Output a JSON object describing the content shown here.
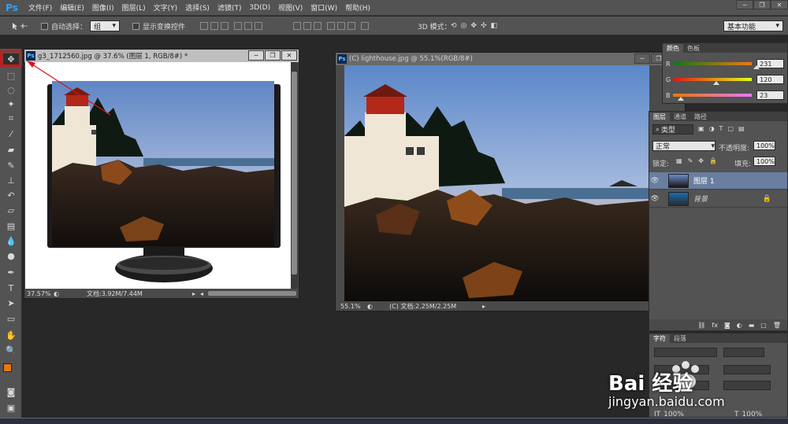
{
  "menubar": {
    "logo": "Ps",
    "items": [
      "文件(F)",
      "编辑(E)",
      "图像(I)",
      "图层(L)",
      "文字(Y)",
      "选择(S)",
      "滤镜(T)",
      "3D(D)",
      "视图(V)",
      "窗口(W)",
      "帮助(H)"
    ],
    "win_min": "─",
    "win_restore": "❐",
    "win_close": "✕"
  },
  "options": {
    "auto_select_label": "自动选择：",
    "auto_select_value": "组",
    "show_transform_label": "显示变换控件",
    "mode_3d_label": "3D 模式：",
    "workspace_value": "基本功能"
  },
  "doc1": {
    "title": "g3_1712560.jpg @ 37.6% (图层 1, RGB/8#) *",
    "zoom": "37.57%",
    "doc_info": "文档:3.92M/7.44M"
  },
  "doc2": {
    "title": "(C) lighthouse.jpg @ 55.1%(RGB/8#)",
    "zoom": "55.1%",
    "doc_info": "(C) 文档:2.25M/2.25M"
  },
  "color_panel": {
    "tabs": [
      "颜色",
      "色板"
    ],
    "channels": [
      {
        "label": "R",
        "value": "231",
        "level": 0.906
      },
      {
        "label": "G",
        "value": "120",
        "level": 0.47
      },
      {
        "label": "B",
        "value": "23",
        "level": 0.09
      }
    ]
  },
  "layers_panel": {
    "tabs": [
      "图层",
      "通道",
      "路径"
    ],
    "filter_label": "类型",
    "blend_mode": "正常",
    "opacity_label": "不透明度:",
    "opacity_value": "100%",
    "lock_label": "锁定:",
    "fill_label": "填充:",
    "fill_value": "100%",
    "layers": [
      {
        "name": "图层 1",
        "selected": true
      },
      {
        "name": "背景",
        "selected": false
      }
    ],
    "bottom_icons": [
      "link-icon",
      "fx-icon",
      "mask-icon",
      "adjustment-icon",
      "folder-icon",
      "new-layer-icon",
      "trash-icon"
    ],
    "fx_label": "fx"
  },
  "char_panel": {
    "tabs": [
      "字符",
      "段落"
    ],
    "size1": "100%",
    "size2": "100%"
  },
  "watermark": {
    "brand": "Bai 经验",
    "url": "jingyan.baidu.com"
  },
  "colors": {
    "foreground": "#e77817",
    "background": "#ffffff",
    "accent_red": "#dd1111"
  }
}
